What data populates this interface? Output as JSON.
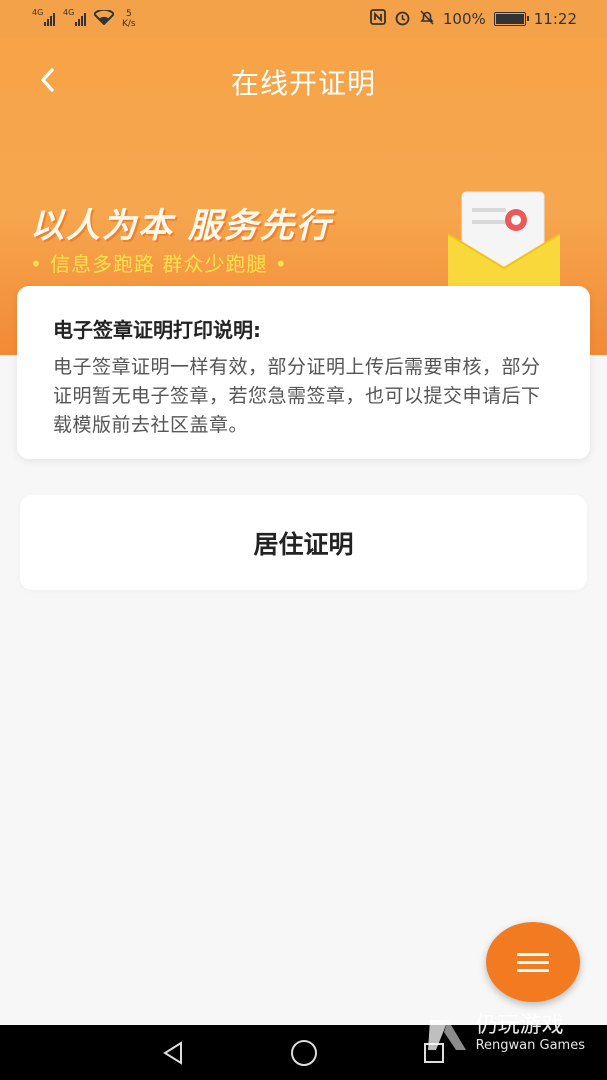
{
  "status_bar": {
    "net1": "4G",
    "net2": "4G",
    "speed_value": "5",
    "speed_unit": "K/s",
    "battery": "100%",
    "time": "11:22"
  },
  "header": {
    "title": "在线开证明",
    "slogan": "以人为本  服务先行",
    "sub_slogan": "• 信息多跑路 群众少跑腿 •"
  },
  "notice": {
    "title": "电子签章证明打印说明:",
    "body": "电子签章证明一样有效，部分证明上传后需要审核，部分证明暂无电子签章，若您急需签章，也可以提交申请后下载模版前去社区盖章。"
  },
  "certificates": [
    {
      "label": "居住证明"
    }
  ],
  "watermark": {
    "cn": "仍玩游戏",
    "en": "Rengwan Games"
  },
  "colors": {
    "header_orange": "#f6a64e",
    "fab_orange": "#f27b22",
    "slogan_yellow": "#ffe24a"
  }
}
